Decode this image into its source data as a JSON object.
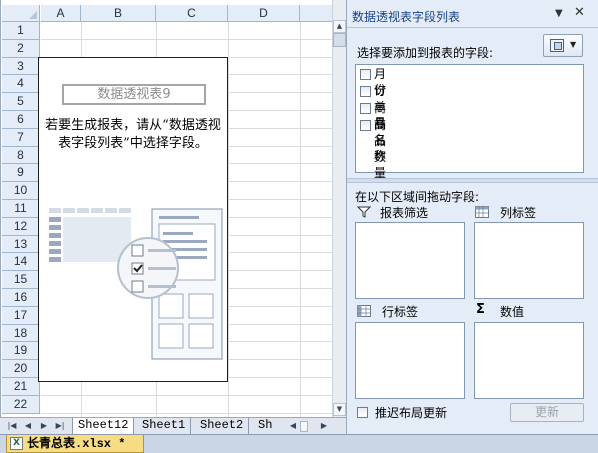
{
  "window_frame": {
    "accent": "#9aa8bb"
  },
  "grid": {
    "columns": [
      "A",
      "B",
      "C",
      "D"
    ],
    "rows": [
      "1",
      "2",
      "3",
      "4",
      "5",
      "6",
      "7",
      "8",
      "9",
      "10",
      "11",
      "12",
      "13",
      "14",
      "15",
      "16",
      "17",
      "18",
      "19",
      "20",
      "21",
      "22"
    ]
  },
  "pivot_placeholder": {
    "title": "数据透视表9",
    "message": "若要生成报表，请从“数据透视表字段列表”中选择字段。"
  },
  "sheet_tabs": {
    "tabs": [
      "Sheet12",
      "Sheet1",
      "Sheet2",
      "Sh"
    ],
    "active": "Sheet12"
  },
  "document": {
    "tab_label": "长青总表.xlsx *",
    "tab_color": "#f6dc83"
  },
  "field_list": {
    "title": "数据透视表字段列表",
    "choose_label": "选择要添加到报表的字段:",
    "fields": [
      {
        "name": "月份",
        "checked": false
      },
      {
        "name": "订单号",
        "checked": false
      },
      {
        "name": "商品名称",
        "checked": false
      },
      {
        "name": "商品数量",
        "checked": false
      }
    ],
    "drag_label": "在以下区域间拖动字段:",
    "areas": {
      "filter": "报表筛选",
      "columns": "列标签",
      "rows": "行标签",
      "values": "数值"
    },
    "defer_label": "推迟布局更新",
    "update_button": "更新",
    "title_color": "#15428b",
    "pane_color": "#e4ecf7"
  }
}
